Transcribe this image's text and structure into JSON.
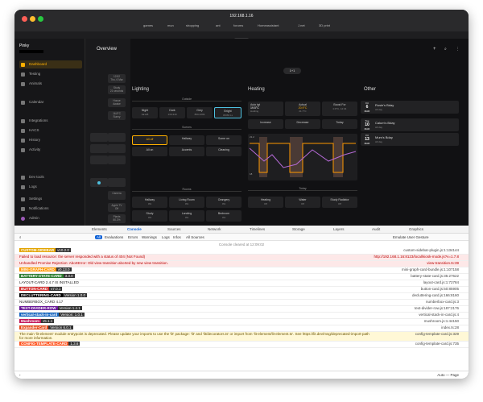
{
  "browser": {
    "url": "192.168.1.16",
    "bookmarks": [
      "games",
      "mun",
      "shopping",
      "ant",
      "forums",
      "Homeassistant",
      "J.net",
      "3D print"
    ],
    "tab_title": "HA"
  },
  "sidebar": {
    "title": "Pinky",
    "items": [
      {
        "label": "Dashboard",
        "active": true
      },
      {
        "label": "Testing"
      },
      {
        "label": "Animals"
      },
      {
        "label": "Calendar"
      },
      {
        "label": "Integrations"
      },
      {
        "label": "HACS"
      },
      {
        "label": "History"
      },
      {
        "label": "Activity"
      },
      {
        "label": "Dev tools"
      },
      {
        "label": "Logs"
      },
      {
        "label": "Settings"
      },
      {
        "label": "Notifications"
      },
      {
        "label": "Admin"
      }
    ]
  },
  "midcol": {
    "tiles": [
      {
        "a": "12:52",
        "b": "Thu, 6 Mar"
      },
      {
        "a": "Study",
        "b": "21 seconds"
      },
      {
        "a": "House",
        "b": "Awake"
      },
      {
        "a": "16.8°C",
        "b": "Sunny"
      },
      {
        "a": "Camera",
        "b": ""
      },
      {
        "a": "Apple TV",
        "b": "Off"
      },
      {
        "a": "Plants",
        "b": "80.2%"
      },
      {
        "a": "Locked",
        "b": ""
      }
    ]
  },
  "header": {
    "title": "Overview",
    "badge": "1+1"
  },
  "lighting": {
    "title": "Lighting",
    "outside_label": "Outside",
    "modes": [
      {
        "label": "Night",
        "value": "0●128"
      },
      {
        "label": "Dark",
        "value": "130-349"
      },
      {
        "label": "Grey",
        "value": "800-3299"
      },
      {
        "label": "Bright",
        "value": "33363 Lx",
        "selected": true
      }
    ],
    "scenes_label": "Scenes",
    "scenes": [
      {
        "label": "All off",
        "on": true
      },
      {
        "label": "Hallway"
      },
      {
        "label": "Some on"
      },
      {
        "label": "All on"
      },
      {
        "label": "Accents"
      },
      {
        "label": "Cleaning"
      }
    ],
    "rooms_label": "Rooms",
    "rooms": [
      {
        "label": "Hallway",
        "value": "0%"
      },
      {
        "label": "Living Room",
        "value": "0%"
      },
      {
        "label": "Orangery",
        "value": "0%"
      },
      {
        "label": "Study",
        "value": "0%"
      },
      {
        "label": "Landing",
        "value": "0%"
      },
      {
        "label": "Bedroom",
        "value": "0%"
      }
    ]
  },
  "heating": {
    "title": "Heating",
    "auto": {
      "label": "Auto tgt",
      "value": "19.5°C",
      "sub": "Holding"
    },
    "actual": {
      "label": "Actual",
      "value": "20.9°C",
      "sub": "21.7°C"
    },
    "boost": {
      "label": "Boost For",
      "value": "0.8°C, 12:34"
    },
    "increase": "Increase",
    "decrease": "Decrease",
    "today": "Today",
    "chart_ymax": "21.2",
    "chart_ymin": "18",
    "today_label": "Today",
    "controls": [
      {
        "label": "Heating",
        "value": "Off"
      },
      {
        "label": "Water",
        "value": "Off"
      },
      {
        "label": "Study Radiator",
        "value": "Off"
      }
    ]
  },
  "other": {
    "title": "Other",
    "events": [
      {
        "dow": "Fri",
        "day": "6",
        "mon": "MAR",
        "title": "Rosie's Bday",
        "sub": "All day"
      },
      {
        "dow": "Tue",
        "day": "10",
        "mon": "MAR",
        "title": "Calum's Bday",
        "sub": "All day"
      },
      {
        "dow": "Fri",
        "day": "13",
        "mon": "MAR",
        "title": "Mum's Bday",
        "sub": "All day"
      }
    ]
  },
  "devtools": {
    "tabs": [
      "Elements",
      "Console",
      "Sources",
      "Network",
      "Timelines",
      "Storage",
      "Layers",
      "Audit",
      "Graphics"
    ],
    "filters": [
      "All",
      "Evaluations",
      "Errors",
      "Warnings",
      "Logs",
      "Infos",
      "All Sources"
    ],
    "emulate": "Emulate User Gesture",
    "cleared": "Console cleared at 12:09:02",
    "rows": [
      {
        "type": "log",
        "text": "CUSTOM-SIDEBAR",
        "badge": "v10.2.0",
        "badge_color": "#e2a300",
        "src": "custom-sidebar-plugin.js:1:134144"
      },
      {
        "type": "err",
        "text": "Failed to load resource: the server responded with a status of 404 (Not Found)",
        "src": "http://192.168.1.16:8123/local/kiosk-mode.js?v=1.7.8"
      },
      {
        "type": "err",
        "text": "Unhandled Promise Rejection: AbortError: Old view transition aborted by new view transition.",
        "src": "view-transition.ts:39"
      },
      {
        "type": "log",
        "text": "MINI-GRAPH-CARD",
        "badge": "v0.13.0",
        "badge_color": "#ff9800",
        "src": "mini-graph-card-bundle.js:1:107158"
      },
      {
        "type": "log",
        "text": "BATTERY-STATE-CARD",
        "badge": "3.3.0",
        "badge_color": "#2e7d32",
        "src": "battery-state-card.js:35:27622"
      },
      {
        "type": "log",
        "text": "LAYOUT-CARD 2.4.7 IS INSTALLED",
        "src": "layout-card.js:1:72784"
      },
      {
        "type": "log",
        "text": "BUTTON-CARD",
        "badge": "v7.0.1",
        "badge_color": "#d32f2f",
        "src": "button-card.js:50:85905"
      },
      {
        "type": "log",
        "text": "DECLUTTERING-CARD",
        "badge": "Version 1.0.0",
        "badge_color": "#000",
        "src": "decluttering-card.js:166:8160"
      },
      {
        "type": "log",
        "text": "NUMBERBOX_CARD 4.17",
        "src": "numberbox-card.js:3"
      },
      {
        "type": "log",
        "text": "TEXT-DIVIDER-ROW",
        "badge": "Version 1.4.1",
        "badge_color": "#6a1b9a",
        "src": "text-divider-row.js:187:2176"
      },
      {
        "type": "log",
        "text": "vertical-stack-in-card",
        "badge": "Version: 1.0.1",
        "badge_color": "#1565c0",
        "src": "vertical-stack-in-card.js:4"
      },
      {
        "type": "log",
        "text": "Mushroom",
        "badge": "v5.1.1",
        "badge_color": "#c2185b",
        "src": "mushroom.js:1:44150"
      },
      {
        "type": "log",
        "text": "Expander-Card",
        "badge": "Version 6.0.1",
        "badge_color": "#e64a19",
        "src": "index.ts:28"
      },
      {
        "type": "warn",
        "text": "The main 'lit-element' module entrypoint is deprecated. Please update your imports to use the 'lit' package: 'lit' and 'lit/decorators.ts' or import from 'lit-element/lit-element.ts'. See https://lit.dev/msg/deprecated-import-path for more information.",
        "src": "config-template-card.js:329"
      },
      {
        "type": "log",
        "text": "CONFIG-TEMPLATE-CARD",
        "badge": "1.3.6",
        "badge_color": "#ff5722",
        "src": "config-template-card.js:735"
      }
    ],
    "input_placeholder": "Auto — Page"
  },
  "colors": {
    "accent": "#ffb000",
    "selected": "#4ec1e0",
    "graph_orange": "#ff9800",
    "graph_purple": "#b56ad6"
  }
}
